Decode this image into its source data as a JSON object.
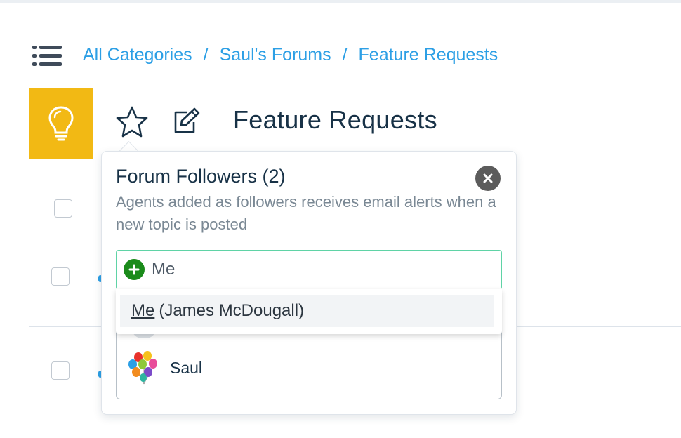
{
  "breadcrumb": {
    "items": [
      "All Categories",
      "Saul's Forums",
      "Feature Requests"
    ],
    "separator": "/"
  },
  "page": {
    "title": "Feature Requests",
    "forum_icon": "lightbulb-icon",
    "forum_icon_color": "#f2b914"
  },
  "popover": {
    "title": "Forum Followers (2)",
    "description": "Agents added as followers receives email alerts when a new topic is posted",
    "search": {
      "value": "Me"
    },
    "suggestion": {
      "match": "Me",
      "rest": "(James McDougall)"
    },
    "followers": [
      {
        "name": "Saul",
        "avatar": "balloons-avatar"
      }
    ]
  },
  "colors": {
    "link": "#2c9fe5",
    "title": "#183247",
    "muted": "#7a8894",
    "focus_border": "#5fd3a6",
    "add_green": "#1b8b1b"
  }
}
